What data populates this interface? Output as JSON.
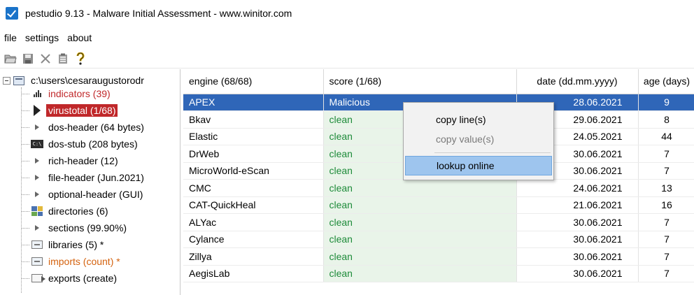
{
  "window": {
    "title": "pestudio 9.13 - Malware Initial Assessment - www.winitor.com"
  },
  "menu": [
    "file",
    "settings",
    "about"
  ],
  "toolbar": {
    "icons": [
      "open-folder-icon",
      "save-icon",
      "close-icon",
      "clipboard-icon",
      "help-icon"
    ]
  },
  "tree": {
    "root": "c:\\users\\cesaraugustorodr",
    "items": [
      {
        "label": "indicators (39)",
        "icon": "bar-chart-icon",
        "style": "red"
      },
      {
        "label": "virustotal (1/68)",
        "icon": "play-icon",
        "style": "selected"
      },
      {
        "label": "dos-header (64 bytes)",
        "icon": "small-arrow-icon",
        "style": "normal"
      },
      {
        "label": "dos-stub (208 bytes)",
        "icon": "terminal-icon",
        "style": "normal"
      },
      {
        "label": "rich-header (12)",
        "icon": "small-arrow-icon",
        "style": "normal"
      },
      {
        "label": "file-header (Jun.2021)",
        "icon": "small-arrow-icon",
        "style": "normal"
      },
      {
        "label": "optional-header (GUI)",
        "icon": "small-arrow-icon",
        "style": "normal"
      },
      {
        "label": "directories (6)",
        "icon": "directories-icon",
        "style": "normal"
      },
      {
        "label": "sections (99.90%)",
        "icon": "small-arrow-icon",
        "style": "normal"
      },
      {
        "label": "libraries (5) *",
        "icon": "library-icon",
        "style": "normal"
      },
      {
        "label": "imports (count) *",
        "icon": "library-icon",
        "style": "orange"
      },
      {
        "label": "exports (create)",
        "icon": "exports-icon",
        "style": "normal"
      }
    ]
  },
  "table": {
    "columns": [
      "engine (68/68)",
      "score (1/68)",
      "date (dd.mm.yyyy)",
      "age (days)"
    ],
    "rows": [
      {
        "engine": "APEX",
        "score": "Malicious",
        "date": "28.06.2021",
        "age": "9",
        "selected": true
      },
      {
        "engine": "Bkav",
        "score": "clean",
        "date": "29.06.2021",
        "age": "8"
      },
      {
        "engine": "Elastic",
        "score": "clean",
        "date": "24.05.2021",
        "age": "44"
      },
      {
        "engine": "DrWeb",
        "score": "clean",
        "date": "30.06.2021",
        "age": "7"
      },
      {
        "engine": "MicroWorld-eScan",
        "score": "clean",
        "date": "30.06.2021",
        "age": "7"
      },
      {
        "engine": "CMC",
        "score": "clean",
        "date": "24.06.2021",
        "age": "13"
      },
      {
        "engine": "CAT-QuickHeal",
        "score": "clean",
        "date": "21.06.2021",
        "age": "16"
      },
      {
        "engine": "ALYac",
        "score": "clean",
        "date": "30.06.2021",
        "age": "7"
      },
      {
        "engine": "Cylance",
        "score": "clean",
        "date": "30.06.2021",
        "age": "7"
      },
      {
        "engine": "Zillya",
        "score": "clean",
        "date": "30.06.2021",
        "age": "7"
      },
      {
        "engine": "AegisLab",
        "score": "clean",
        "date": "30.06.2021",
        "age": "7"
      }
    ]
  },
  "context_menu": {
    "items": [
      {
        "label": "copy line(s)",
        "enabled": true
      },
      {
        "label": "copy value(s)",
        "enabled": false
      },
      {
        "label": "lookup online",
        "enabled": true,
        "highlighted": true
      }
    ]
  },
  "colors": {
    "selection_blue": "#2f66b8",
    "selected_tree_red": "#c0282a",
    "clean_green": "#1e8b3a",
    "imports_orange": "#d4620e",
    "menu_highlight": "#9ec5ee"
  }
}
